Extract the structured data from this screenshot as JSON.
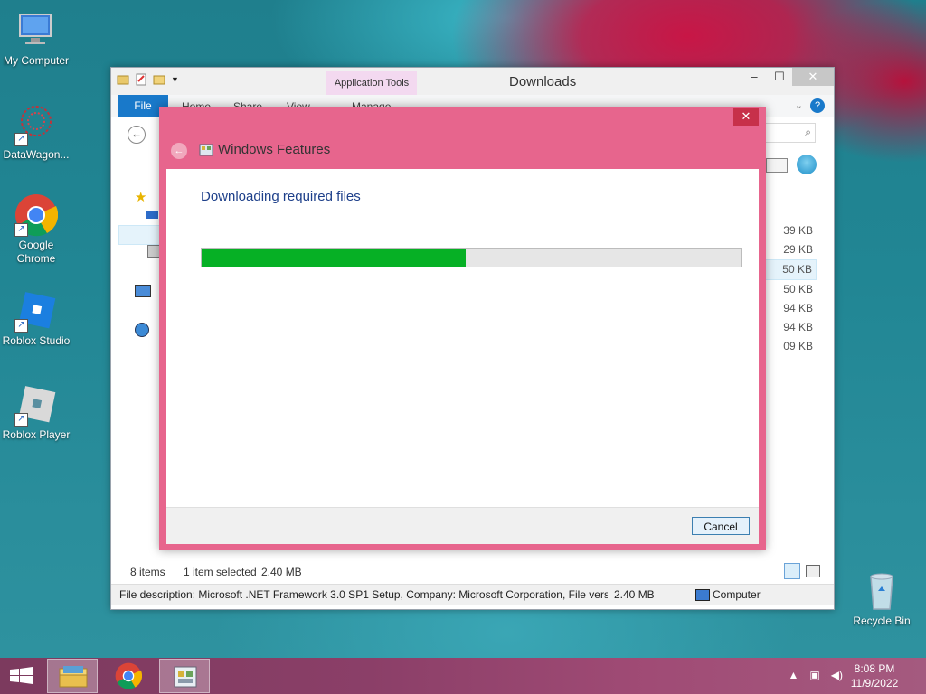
{
  "desktop": {
    "icons": [
      {
        "label": "My Computer",
        "icon": "computer-icon"
      },
      {
        "label": "DataWagon...",
        "icon": "datawagon-icon"
      },
      {
        "label": "Google Chrome",
        "icon": "chrome-icon"
      },
      {
        "label": "Roblox Studio",
        "icon": "roblox-studio-icon"
      },
      {
        "label": "Roblox Player",
        "icon": "roblox-player-icon"
      },
      {
        "label": "Recycle Bin",
        "icon": "recycle-bin-icon"
      }
    ]
  },
  "explorer": {
    "title": "Downloads",
    "contextual_tab": "Application Tools",
    "tabs": [
      "File",
      "Home",
      "Share",
      "View",
      "Manage"
    ],
    "sizes": [
      "39 KB",
      "29 KB",
      "50 KB",
      "50 KB",
      "94 KB",
      "94 KB",
      "09 KB"
    ],
    "status": {
      "items": "8 items",
      "selected": "1 item selected",
      "selected_size": "2.40 MB"
    },
    "details": {
      "description": "File description: Microsoft .NET Framework 3.0 SP1 Setup, Company: Microsoft Corporation, File versior",
      "size": "2.40 MB",
      "location": "Computer"
    }
  },
  "dialog": {
    "title": "Windows Features",
    "heading": "Downloading required files",
    "progress": 0.49,
    "cancel_label": "Cancel"
  },
  "taskbar": {
    "time": "8:08 PM",
    "date": "11/9/2022"
  },
  "colors": {
    "accent": "#e7658d",
    "progress": "#06b025",
    "file_tab": "#1979ca"
  }
}
